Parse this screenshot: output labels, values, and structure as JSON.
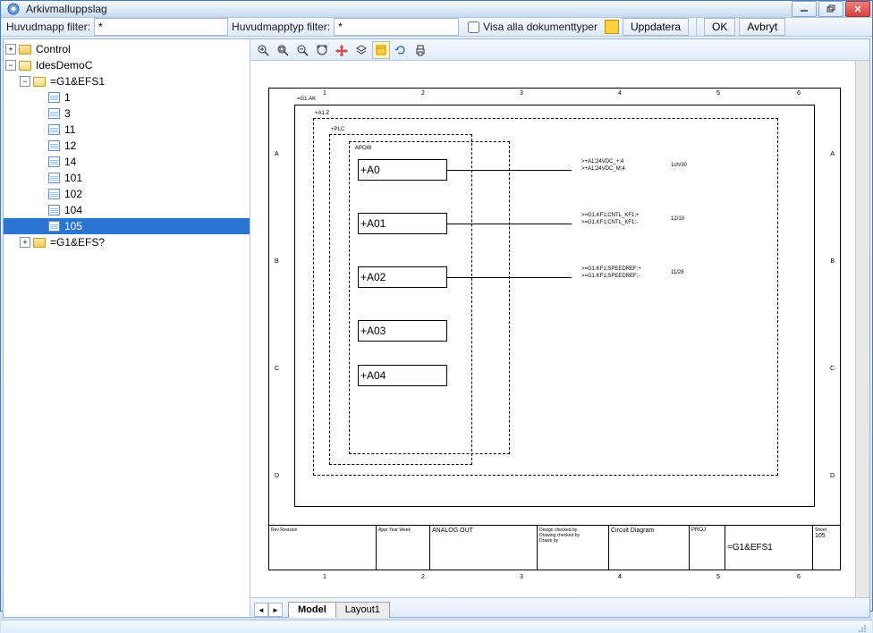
{
  "window": {
    "title": "Arkivmalluppslag"
  },
  "toolbar": {
    "filter1_label": "Huvudmapp filter:",
    "filter1_value": "*",
    "filter2_label": "Huvudmapptyp filter:",
    "filter2_value": "*",
    "show_all_label": "Visa alla dokumenttyper",
    "update_label": "Uppdatera",
    "ok_label": "OK",
    "cancel_label": "Avbryt"
  },
  "tree": {
    "root1": "Control",
    "root2": "IdesDemoC",
    "sub1": "=G1&EFS1",
    "items": [
      "1",
      "3",
      "11",
      "12",
      "14",
      "101",
      "102",
      "104",
      "105"
    ],
    "selected": "105",
    "sub2": "=G1&EFS?"
  },
  "viewer": {
    "tabs": {
      "active": "Model",
      "other": "Layout1"
    },
    "drawing": {
      "top_label": "=G1.AK",
      "a1z": "+A1.Z",
      "plc": "+PLC",
      "apow": "APOW",
      "blocks": [
        "+A0",
        "+A01",
        "+A02",
        "+A03",
        "+A04"
      ],
      "sigs": [
        ">+A1;24VDC_+;4",
        ">+A1;24VDC_M;4",
        ">=G1.KF1;CNTL_KF1;+",
        ">=G1.KF1;CNTL_KF1;-",
        ">=G1.KF1;SPEEDREF;+",
        ">=G1.KF1;SPEEDREF;-"
      ],
      "refs": [
        "1ch/30",
        "12/10",
        "11/28"
      ],
      "titleblock": {
        "analog": "ANALOG OUT",
        "circuit": "Circuit Diagram",
        "ref": "=G1&EFS1",
        "sheet": "105",
        "proj": "PROJ"
      },
      "cols": [
        "1",
        "2",
        "3",
        "4",
        "5",
        "6"
      ],
      "rows": [
        "A",
        "B",
        "C",
        "D"
      ]
    }
  }
}
